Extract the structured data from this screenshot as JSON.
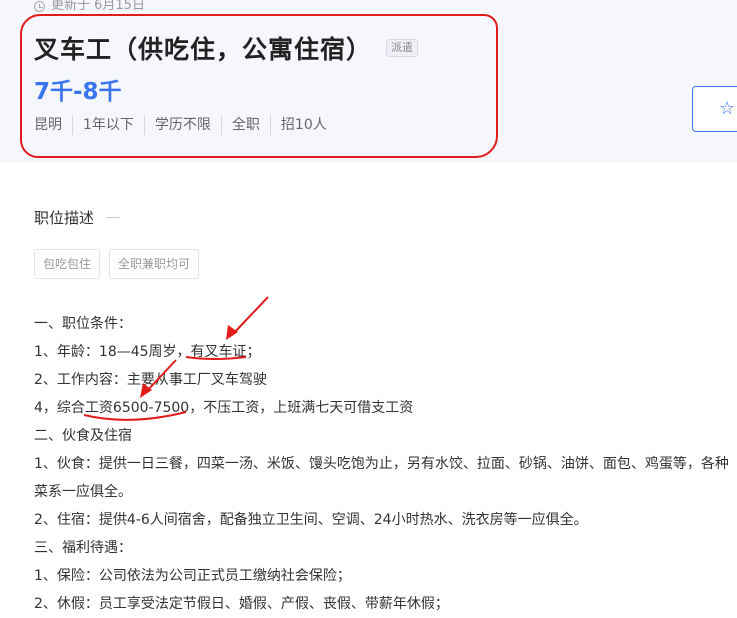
{
  "header": {
    "updated": "更新于  6月15日",
    "title": "叉车工（供吃住，公寓住宿）",
    "badge": "派遣",
    "salary": "7千-8千",
    "meta": [
      "昆明",
      "1年以下",
      "学历不限",
      "全职",
      "招10人"
    ]
  },
  "section": {
    "title": "职位描述"
  },
  "tags": [
    "包吃包住",
    "全职兼职均可"
  ],
  "description": [
    "一、职位条件：",
    "1、年龄：18—45周岁，有叉车证；",
    "2、工作内容：主要从事工厂叉车驾驶",
    "4，综合工资6500-7500，不压工资，上班满七天可借支工资",
    "二、伙食及住宿",
    "1、伙食：提供一日三餐，四菜一汤、米饭、馒头吃饱为止，另有水饺、拉面、砂锅、油饼、面包、鸡蛋等，各种",
    "菜系一应俱全。",
    "2、住宿：提供4-6人间宿舍，配备独立卫生间、空调、24小时热水、洗衣房等一应俱全。",
    "三、福利待遇：",
    "1、保险：公司依法为公司正式员工缴纳社会保险；",
    "2、休假：员工享受法定节假日、婚假、产假、丧假、带薪年休假；"
  ],
  "icons": {
    "clock": "clock-icon",
    "star": "star-icon"
  },
  "colors": {
    "accent": "#3a75f0",
    "annotation": "#e21b1b"
  }
}
